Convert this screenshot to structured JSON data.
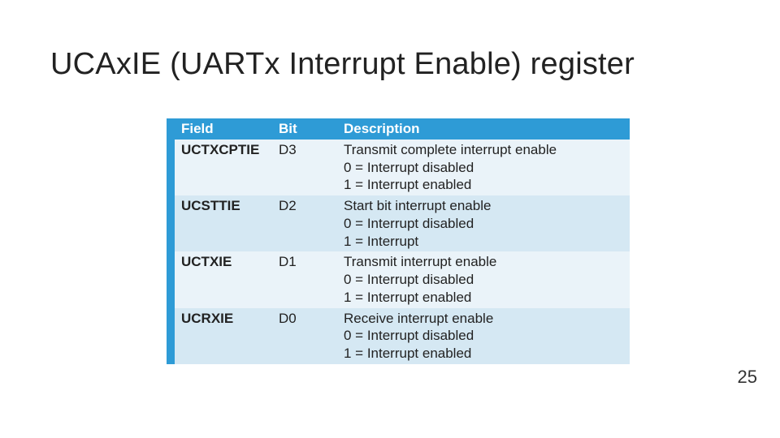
{
  "title": "UCAxIE (UARTx Interrupt Enable) register",
  "page_number": "25",
  "columns": {
    "field": "Field",
    "bit": "Bit",
    "desc": "Description"
  },
  "rows": [
    {
      "field": "UCTXCPTIE",
      "bit": "D3",
      "desc_lines": [
        "Transmit complete interrupt enable",
        "0 = Interrupt disabled",
        "1 = Interrupt enabled"
      ]
    },
    {
      "field": "UCSTTIE",
      "bit": "D2",
      "desc_lines": [
        "Start bit interrupt enable",
        "0 = Interrupt disabled",
        "1 = Interrupt"
      ]
    },
    {
      "field": "UCTXIE",
      "bit": "D1",
      "desc_lines": [
        "Transmit interrupt enable",
        "0 = Interrupt disabled",
        "1 = Interrupt enabled"
      ]
    },
    {
      "field": "UCRXIE",
      "bit": "D0",
      "desc_lines": [
        "Receive interrupt enable",
        "0 = Interrupt disabled",
        "1 = Interrupt enabled"
      ]
    }
  ]
}
